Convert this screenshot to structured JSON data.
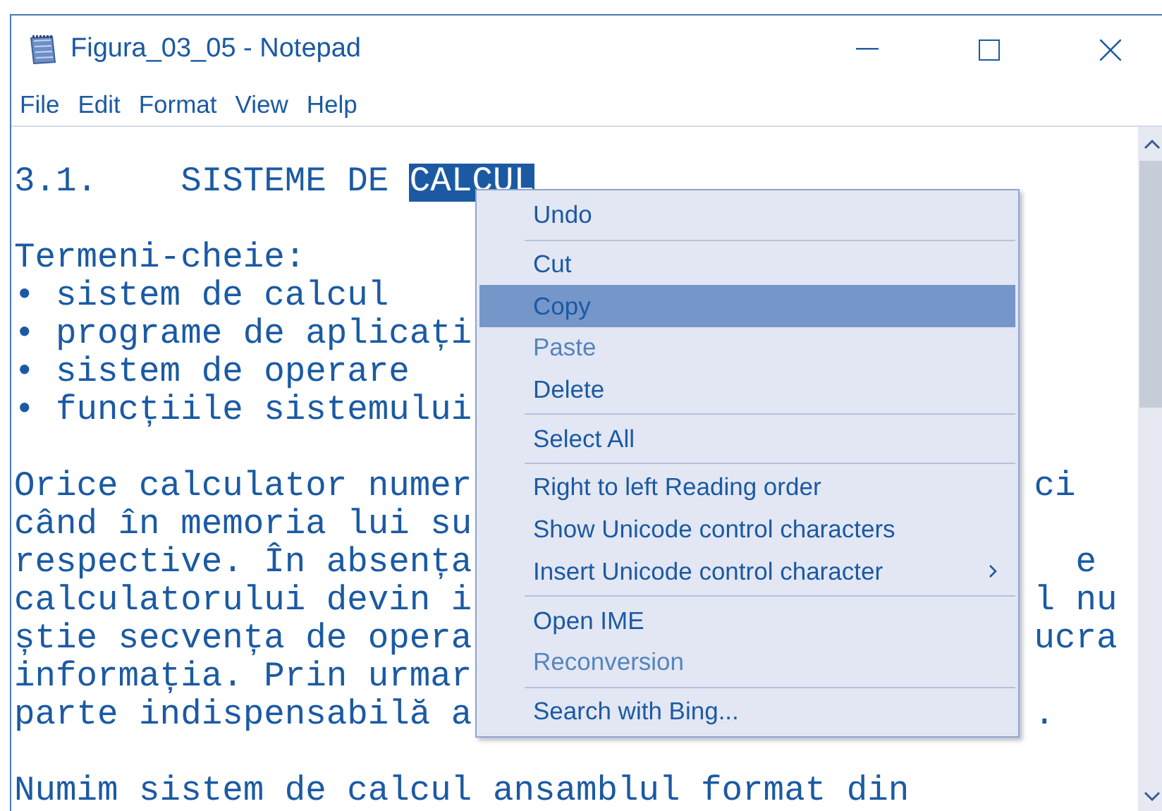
{
  "window": {
    "title": "Figura_03_05 - Notepad"
  },
  "menu_bar": [
    "File",
    "Edit",
    "Format",
    "View",
    "Help"
  ],
  "editor": {
    "lines": [
      {
        "kind": "text",
        "text": "3.1.    SISTEME DE ",
        "selection": "CALCUL"
      },
      {
        "kind": "blank"
      },
      {
        "kind": "text",
        "text": "Termeni-cheie:"
      },
      {
        "kind": "text",
        "text": "• sistem de calcul"
      },
      {
        "kind": "text",
        "text": "• programe de aplicați"
      },
      {
        "kind": "text",
        "text": "• sistem de operare"
      },
      {
        "kind": "text",
        "text": "• funcțiile sistemului"
      },
      {
        "kind": "blank"
      },
      {
        "kind": "text",
        "text": "Orice calculator numer",
        "tail": "ci"
      },
      {
        "kind": "text",
        "text": "când în memoria lui su"
      },
      {
        "kind": "text",
        "text": "respective. În absența",
        "tail": "e"
      },
      {
        "kind": "text",
        "text": "calculatorului devin i",
        "tail": "l nu"
      },
      {
        "kind": "text",
        "text": "știe secvența de opera",
        "tail": "ucra"
      },
      {
        "kind": "text",
        "text": "informația. Prin urmar"
      },
      {
        "kind": "text",
        "text": "parte indispensabilă a",
        "tail": "."
      },
      {
        "kind": "blank"
      },
      {
        "kind": "text",
        "text": "Numim sistem de calcul ansamblul format din"
      }
    ]
  },
  "context_menu": [
    {
      "kind": "item",
      "label": "Undo",
      "disabled": false,
      "selected": false,
      "submenu": false
    },
    {
      "kind": "separator"
    },
    {
      "kind": "item",
      "label": "Cut",
      "disabled": false,
      "selected": false,
      "submenu": false
    },
    {
      "kind": "item",
      "label": "Copy",
      "disabled": false,
      "selected": true,
      "submenu": false
    },
    {
      "kind": "item",
      "label": "Paste",
      "disabled": true,
      "selected": false,
      "submenu": false
    },
    {
      "kind": "item",
      "label": "Delete",
      "disabled": false,
      "selected": false,
      "submenu": false
    },
    {
      "kind": "separator"
    },
    {
      "kind": "item",
      "label": "Select All",
      "disabled": false,
      "selected": false,
      "submenu": false
    },
    {
      "kind": "separator"
    },
    {
      "kind": "item",
      "label": "Right to left Reading order",
      "disabled": false,
      "selected": false,
      "submenu": false
    },
    {
      "kind": "item",
      "label": "Show Unicode control characters",
      "disabled": false,
      "selected": false,
      "submenu": false
    },
    {
      "kind": "item",
      "label": "Insert Unicode control character",
      "disabled": false,
      "selected": false,
      "submenu": true
    },
    {
      "kind": "separator"
    },
    {
      "kind": "item",
      "label": "Open IME",
      "disabled": false,
      "selected": false,
      "submenu": false
    },
    {
      "kind": "item",
      "label": "Reconversion",
      "disabled": true,
      "selected": false,
      "submenu": false
    },
    {
      "kind": "separator"
    },
    {
      "kind": "item",
      "label": "Search with Bing...",
      "disabled": false,
      "selected": false,
      "submenu": false
    }
  ]
}
